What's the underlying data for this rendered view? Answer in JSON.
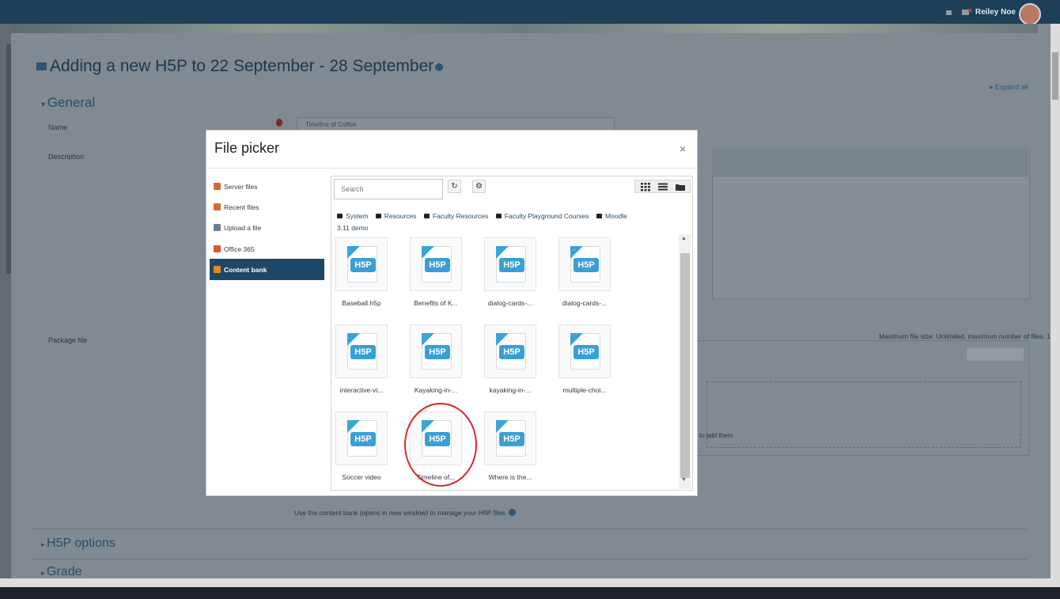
{
  "user": {
    "name": "Reiley Noe"
  },
  "page": {
    "heading": "Adding a new H5P to 22 September - 28 September",
    "expand_all": "Expand all",
    "general": "General",
    "name_label": "Name",
    "name_value": "Timeline of Coffee",
    "description_label": "Description",
    "package_label": "Package file",
    "max_file": "Maximum file size: Unlimited, maximum number of files: 1",
    "drop_hint": "to add them.",
    "content_bank_note": "Use the content bank (opens in new window) to manage your H5P files",
    "h5p_options": "H5P options",
    "grade": "Grade"
  },
  "dialog": {
    "title": "File picker",
    "close": "×",
    "repos": [
      {
        "label": "Server files",
        "icon": "server-files-icon",
        "color": "#d06f2a"
      },
      {
        "label": "Recent files",
        "icon": "recent-files-icon",
        "color": "#d06f2a"
      },
      {
        "label": "Upload a file",
        "icon": "upload-icon",
        "color": "#6b7f94"
      },
      {
        "label": "Office 365",
        "icon": "office365-icon",
        "color": "#e0532a"
      },
      {
        "label": "Content bank",
        "icon": "content-bank-icon",
        "color": "#e08a2a"
      }
    ],
    "search_placeholder": "Search",
    "refresh": "↻",
    "settings": "⚙",
    "breadcrumb": [
      "System",
      "Resources",
      "Faculty Resources",
      "Faculty Playground Courses",
      "Moodle 3.11 demo"
    ],
    "files": [
      "Baseball.h5p",
      "Benefits of K...",
      "dialog-cards-...",
      "dialog-cards-...",
      "interactive-vi...",
      "Kayaking-in-...",
      "kayaking-in-...",
      "multiple-choi...",
      "Soccer video",
      "Timeline of...",
      "Where is the..."
    ],
    "file_icon_text": "H5P"
  }
}
